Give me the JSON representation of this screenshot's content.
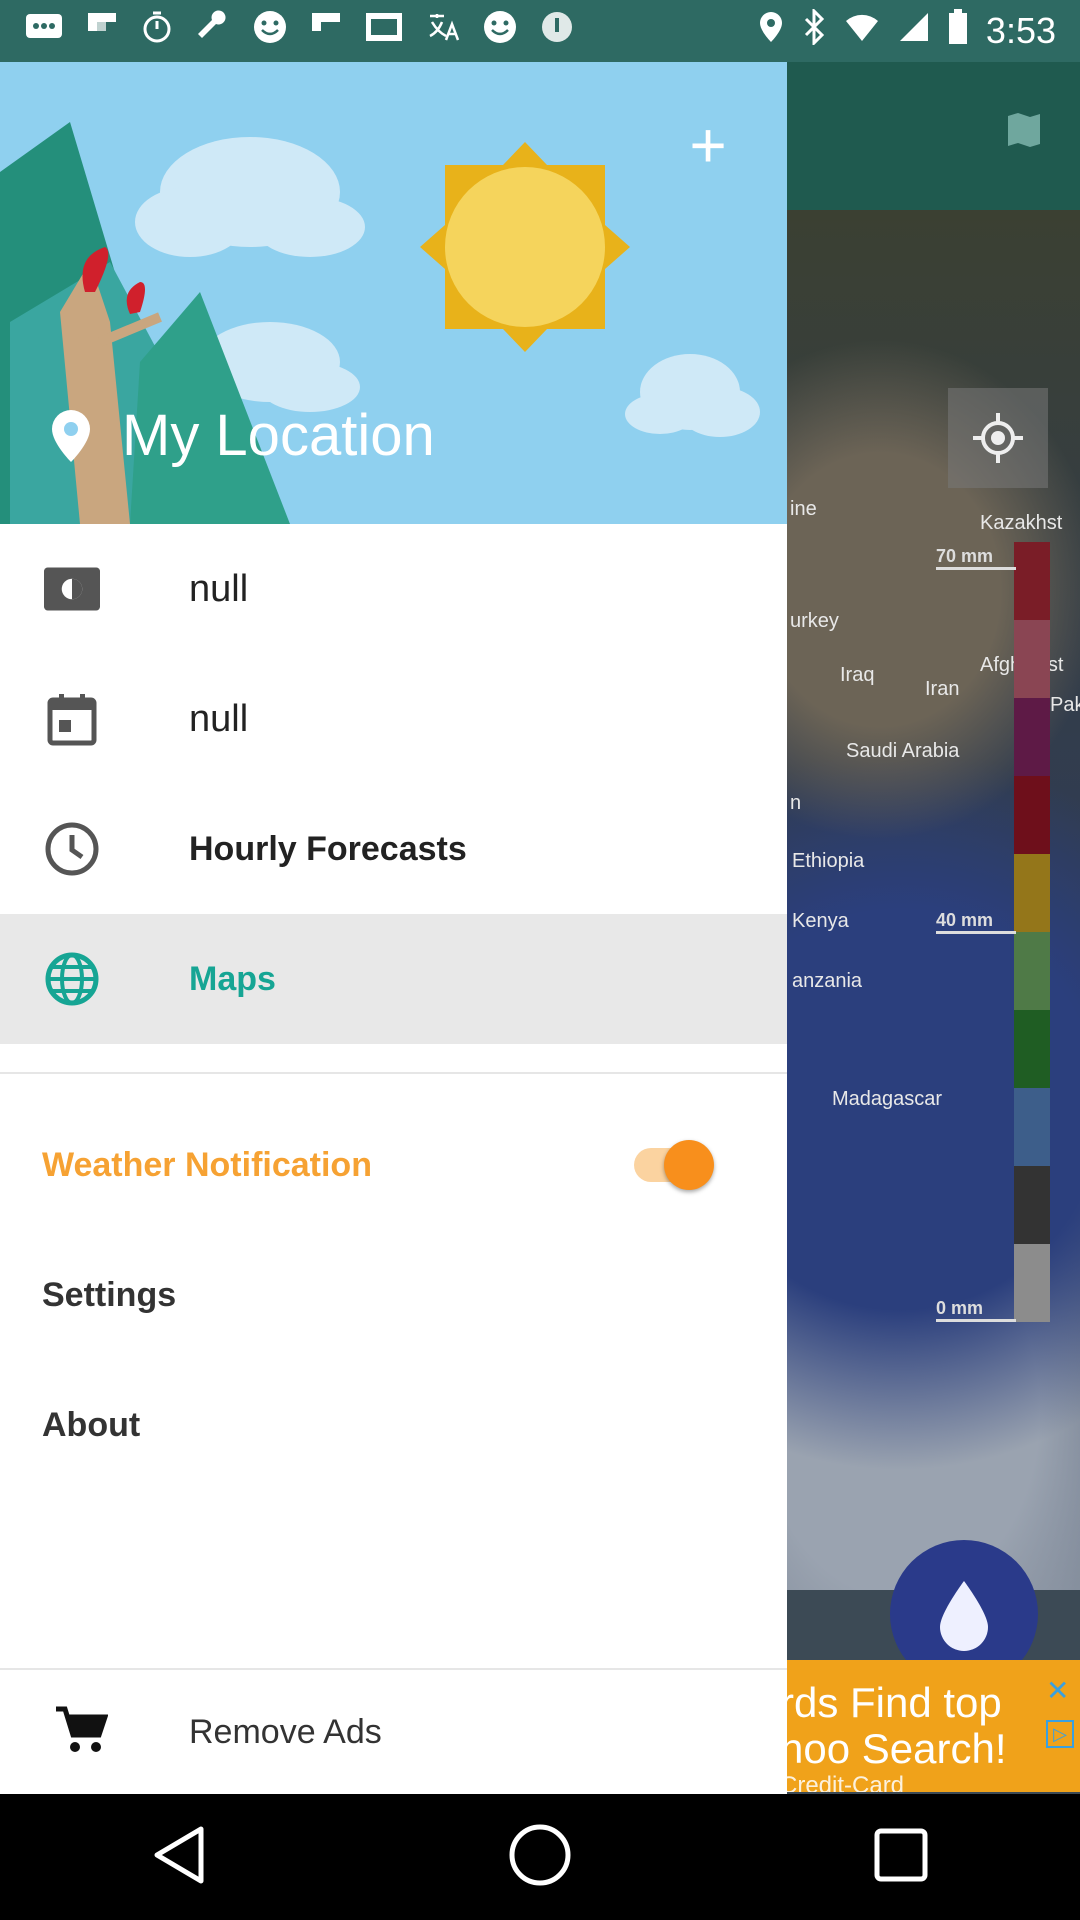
{
  "status_bar": {
    "time": "3:53"
  },
  "drawer": {
    "header": {
      "title": "My Location"
    },
    "menu": [
      {
        "label": "null",
        "icon": "brightness-icon"
      },
      {
        "label": "null",
        "icon": "calendar-icon"
      },
      {
        "label": "Hourly Forecasts",
        "icon": "clock-icon"
      },
      {
        "label": "Maps",
        "icon": "globe-icon",
        "selected": true
      }
    ],
    "weather_notification": {
      "label": "Weather Notification",
      "enabled": true
    },
    "settings_label": "Settings",
    "about_label": "About",
    "remove_ads_label": "Remove Ads"
  },
  "map": {
    "labels": [
      "ine",
      "Kazakhst",
      "urkey",
      "Iraq",
      "Iran",
      "Afghanist",
      "Pakistan",
      "Saudi Arabia",
      "Ethiopia",
      "Kenya",
      "anzania",
      "Madagascar",
      "n"
    ],
    "legend_ticks": [
      "70 mm",
      "40 mm",
      "0 mm"
    ],
    "legend_colors": [
      "#7a1d27",
      "#8a4553",
      "#5e1a46",
      "#6e0f1b",
      "#94761a",
      "#4f7a47",
      "#1f5d23",
      "#3d5e8a",
      "#333333",
      "#8c8c8c"
    ]
  },
  "ad": {
    "line1": "rds Find top",
    "line2": "hoo Search!",
    "line3": "Credit-Card"
  },
  "colors": {
    "accent_teal": "#16a594",
    "notification_orange": "#f6a233",
    "header_sky": "#8fd0ef"
  }
}
